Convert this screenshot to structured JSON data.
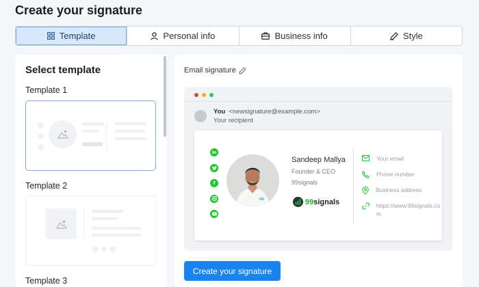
{
  "page": {
    "title": "Create your signature"
  },
  "tabs": [
    {
      "label": "Template",
      "icon": "grid-icon",
      "active": true
    },
    {
      "label": "Personal info",
      "icon": "user-icon",
      "active": false
    },
    {
      "label": "Business info",
      "icon": "briefcase-icon",
      "active": false
    },
    {
      "label": "Style",
      "icon": "pen-icon",
      "active": false
    }
  ],
  "templates_panel": {
    "title": "Select template",
    "items": [
      {
        "label": "Template 1",
        "selected": true
      },
      {
        "label": "Template 2",
        "selected": false
      },
      {
        "label": "Template 3",
        "selected": false
      }
    ]
  },
  "preview_panel": {
    "label": "Email signature",
    "window_dots": [
      "#ea4335",
      "#f5b400",
      "#34c84a"
    ],
    "sender_name": "You",
    "sender_email": "<newsignature@example.com>",
    "recipient": "Your recipient",
    "signature": {
      "name": "Sandeep Mallya",
      "role": "Founder & CEO",
      "company": "99signals",
      "logo_text": "99signals",
      "socials": [
        "linkedin-icon",
        "twitter-icon",
        "facebook-icon",
        "instagram-icon",
        "youtube-icon"
      ],
      "contacts": [
        {
          "icon": "mail-icon",
          "text": "Your email"
        },
        {
          "icon": "phone-icon",
          "text": "Phone number"
        },
        {
          "icon": "location-icon",
          "text": "Business address"
        },
        {
          "icon": "link-icon",
          "text": "https://www.99signals.com"
        }
      ],
      "accent_color": "#1ec72c"
    }
  },
  "create_button": {
    "label": "Create your signature",
    "color": "#1a84ee"
  }
}
